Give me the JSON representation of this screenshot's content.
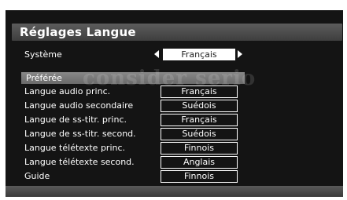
{
  "title": "Réglages Langue",
  "system": {
    "label": "Système",
    "value": "Français"
  },
  "section": {
    "label": "Préférée"
  },
  "watermark": "consider serio",
  "settings": [
    {
      "label": "Langue audio princ.",
      "value": "Français"
    },
    {
      "label": "Langue audio secondaire",
      "value": "Suédois"
    },
    {
      "label": "Langue de ss-titr. princ.",
      "value": "Français"
    },
    {
      "label": "Langue de ss-titr. second.",
      "value": "Suédois"
    },
    {
      "label": "Langue télétexte princ.",
      "value": "Finnois"
    },
    {
      "label": "Langue télétexte second.",
      "value": "Anglais"
    },
    {
      "label": "Guide",
      "value": "Finnois"
    }
  ],
  "colors": {
    "background": "#141414",
    "title_bar": "#4a4a4a",
    "section_header": "#7a7a7a",
    "text": "#ffffff"
  }
}
